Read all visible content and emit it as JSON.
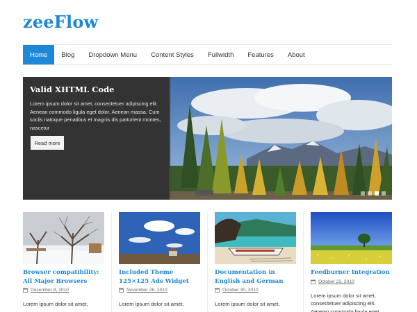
{
  "site": {
    "title": "zeeFlow"
  },
  "nav": {
    "items": [
      {
        "label": "Home",
        "active": true
      },
      {
        "label": "Blog"
      },
      {
        "label": "Dropdown Menu"
      },
      {
        "label": "Content Styles"
      },
      {
        "label": "Fullwidth"
      },
      {
        "label": "Features"
      },
      {
        "label": "About"
      }
    ]
  },
  "slider": {
    "title": "Valid XHTML Code",
    "text": "Lorem ipsum dolor sit amet, consectetuer adipiscing elit. Aenean commodo ligula eget dolor. Aenean massa. Cum sociis natoque penatibus et magnis dis parturient montes, nascetur",
    "button_label": "Read more",
    "active_dot": 3,
    "dot_count": 4
  },
  "posts": [
    {
      "title": "Browser compatibility: All Major Browsers",
      "date": "December 8, 2010",
      "excerpt": "Lorem ipsum dolor sit amet,",
      "thumb": "winter-trees"
    },
    {
      "title": "Included Theme 125×125 Ads Widget",
      "date": "November 28, 2010",
      "excerpt": "Lorem ipsum dolor sit amet,",
      "thumb": "sky-field"
    },
    {
      "title": "Documentation in English and German",
      "date": "October 30, 2010",
      "excerpt": "Lorem ipsum dolor sit amet,",
      "thumb": "beach-boat"
    },
    {
      "title": "Feedburner Integration",
      "date": "October 23, 2010",
      "excerpt": "Lorem ipsum dolor sit amet, consectetuer adipiscing elit. Aenean commodo ligula eget",
      "thumb": "green-field"
    }
  ],
  "icons": {
    "calendar": "calendar-icon"
  },
  "colors": {
    "brand": "#1e88d8",
    "slider_panel": "#333333",
    "nav_active": "#1e88d8"
  }
}
